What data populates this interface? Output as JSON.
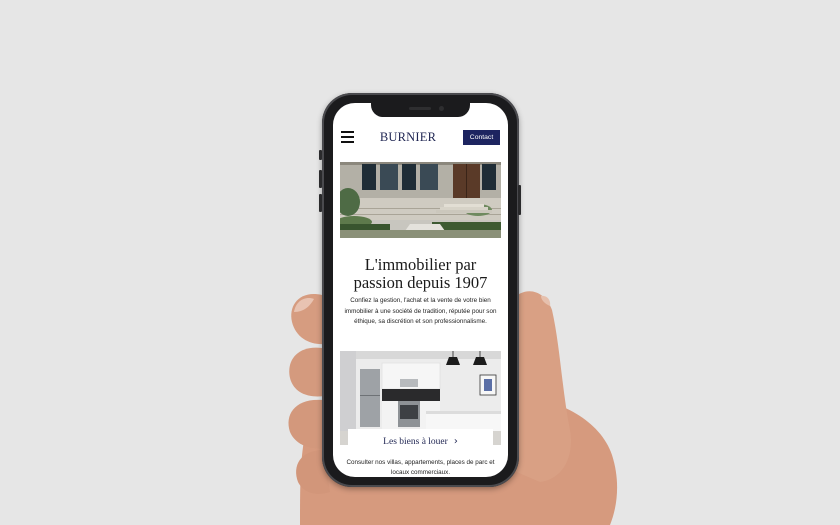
{
  "header": {
    "brand": "BURNIER",
    "contact_label": "Contact"
  },
  "hero": {
    "title_line1": "L'immobilier par",
    "title_line2": "passion depuis 1907",
    "description": "Confiez la gestion, l'achat et la vente de votre bien immobilier à une société de tradition, réputée pour son éthique, sa discrétion et son professionnalisme."
  },
  "rentals": {
    "button_label": "Les biens à louer",
    "chevron": "›",
    "description": "Consulter nos villas, appartements, places de parc et locaux commerciaux."
  }
}
